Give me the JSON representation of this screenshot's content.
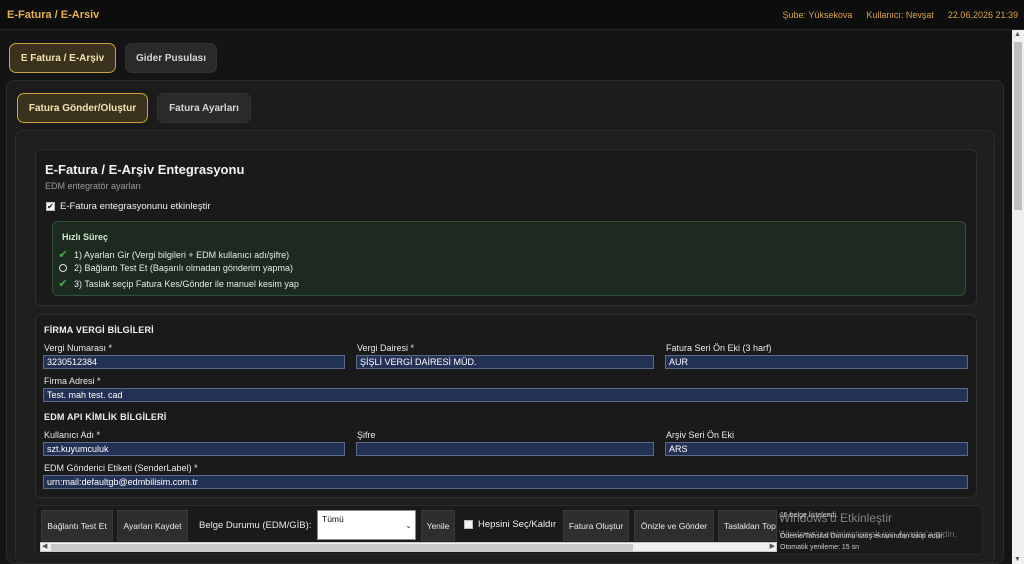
{
  "app": {
    "title": "E-Fatura / E-Arsiv",
    "branch": "Şube: Yüksekova",
    "user": "Kullanıcı: Nevşat",
    "datetime": "22.06.2026 21:39"
  },
  "main_tabs": [
    {
      "label": "E Fatura / E-Arşiv",
      "active": true
    },
    {
      "label": "Gider Pusulası",
      "active": false
    }
  ],
  "sub_tabs": [
    {
      "label": "Fatura Gönder/Oluştur",
      "active": true
    },
    {
      "label": "Fatura Ayarları",
      "active": false
    }
  ],
  "integration": {
    "title": "E-Fatura / E-Arşiv Entegrasyonu",
    "subtitle": "EDM entegratör ayarları",
    "enable_label": "E-Fatura entegrasyonunu etkinleştir",
    "enable_checked": true
  },
  "quick_steps": {
    "title": "Hızlı Süreç",
    "steps": [
      {
        "text": "1) Ayarları Gir (Vergi bilgileri + EDM kullanıcı adı/şifre)",
        "status": "done"
      },
      {
        "text": "2) Bağlantı Test Et (Başarılı olmadan gönderim yapma)",
        "status": "pending"
      },
      {
        "text": "3) Taslak seçip Fatura Kes/Gönder ile manuel kesim yap",
        "status": "done"
      }
    ]
  },
  "tax_section": {
    "title": "FİRMA VERGİ BİLGİLERİ",
    "tax_no_label": "Vergi Numarası *",
    "tax_no_value": "3230512384",
    "tax_office_label": "Vergi Dairesi *",
    "tax_office_value": "ŞİŞLİ VERGİ DAİRESİ MÜD.",
    "series_label": "Fatura Seri Ön Eki (3 harf)",
    "series_value": "AUR",
    "address_label": "Firma Adresi *",
    "address_value": "Test. mah test. cad"
  },
  "api_section": {
    "title": "EDM API KİMLİK BİLGİLERİ",
    "username_label": "Kullanıcı Adı *",
    "username_value": "szt.kuyumculuk",
    "password_label": "Şifre",
    "password_value": "",
    "archive_series_label": "Arşiv Seri Ön Eki",
    "archive_series_value": "ARS",
    "sender_label_label": "EDM Gönderici Etiketi (SenderLabel) *",
    "sender_label_value": "urn:mail:defaultgb@edmbilisim.com.tr"
  },
  "toolbar": {
    "test_button": "Bağlantı Test Et",
    "save_button": "Ayarları Kaydet",
    "status_label": "Belge Durumu (EDM/GİB):",
    "status_select": "Tümü",
    "refresh_button": "Yenile",
    "select_all_label": "Hepsini Seç/Kaldır",
    "create_button": "Fatura Oluştur",
    "preview_send_button": "Önizle ve Gönder",
    "drafts_button": "Taslakları Top"
  },
  "status_bar": {
    "line1": "15 belge listelendi.",
    "line2": "Ödeme/Tahsilat Durumu satış ekranından takip edilir.",
    "line3": "Otomatik yenileme: 15 sn"
  },
  "watermark": {
    "title": "Windows'u Etkinleştir",
    "subtitle": "Windows'u etkinleştirmek için Ayarlar'a gidin."
  }
}
